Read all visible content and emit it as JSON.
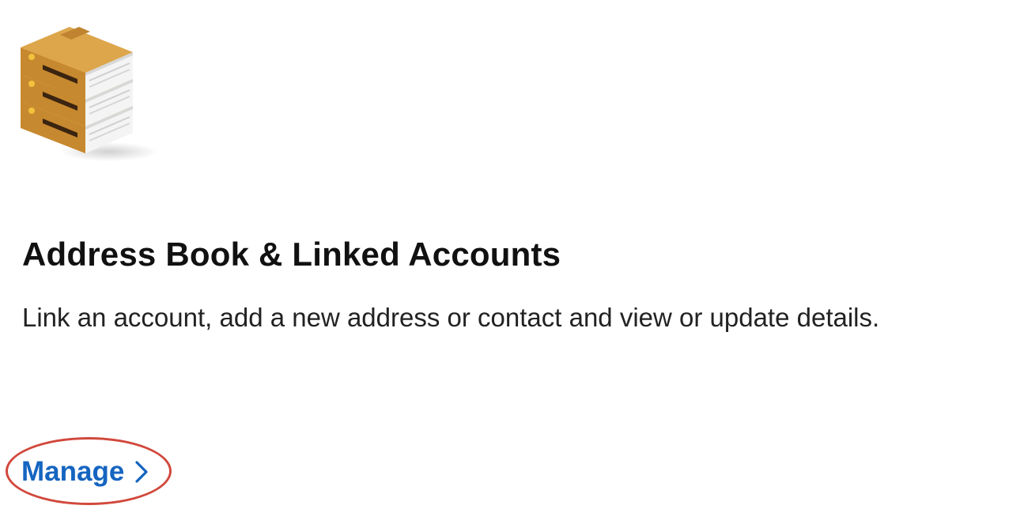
{
  "card": {
    "icon": "stacked-books-icon",
    "title": "Address Book & Linked Accounts",
    "description": "Link an account, add a new address or contact and view or update details.",
    "link": {
      "label": "Manage",
      "icon": "chevron-right-icon",
      "color": "#1565c0"
    }
  },
  "annotation": {
    "highlight_color": "#d1483c"
  }
}
